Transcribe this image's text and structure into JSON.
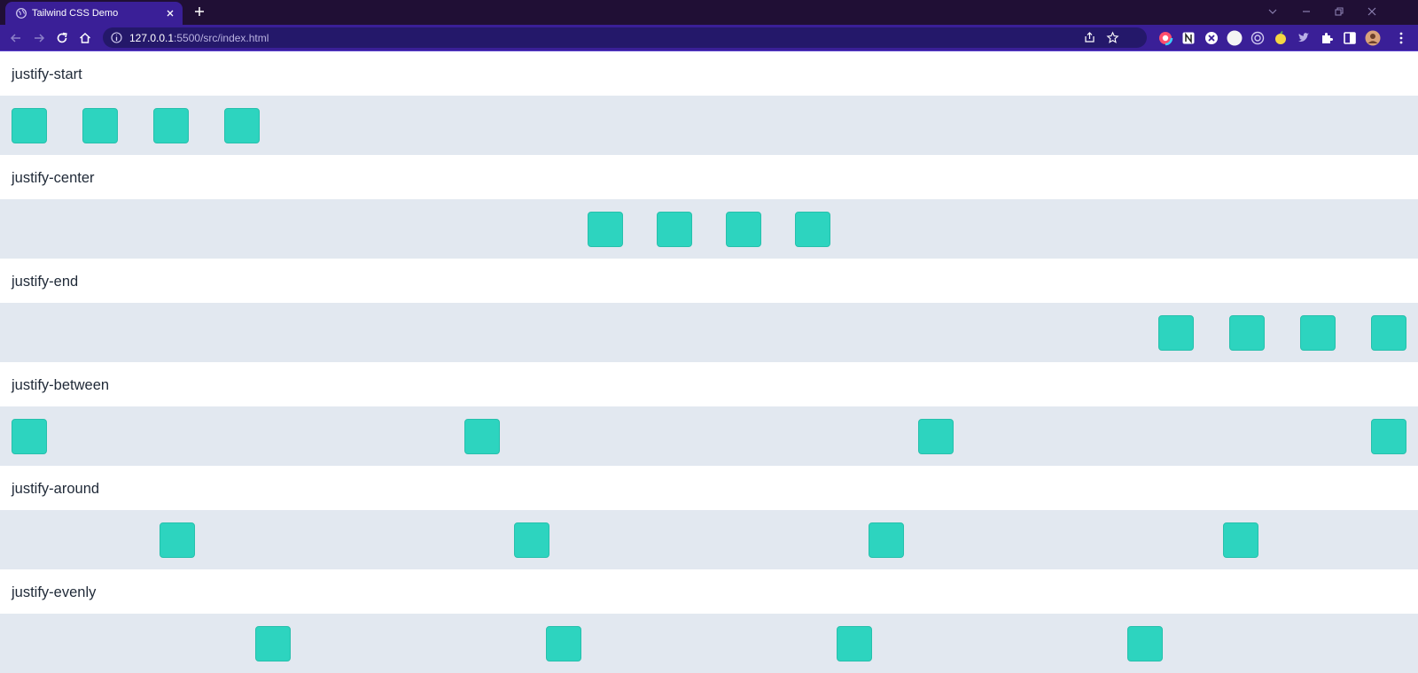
{
  "browser": {
    "tab_title": "Tailwind CSS Demo",
    "url_host": "127.0.0.1",
    "url_path": ":5500/src/index.html",
    "tab_color": "#3a1f97",
    "frame_color": "#200f35"
  },
  "sections": [
    {
      "label": "justify-start",
      "items": 4
    },
    {
      "label": "justify-center",
      "items": 4
    },
    {
      "label": "justify-end",
      "items": 4
    },
    {
      "label": "justify-between",
      "items": 4
    },
    {
      "label": "justify-around",
      "items": 4
    },
    {
      "label": "justify-evenly",
      "items": 4
    }
  ],
  "colors": {
    "box": "#2dd4bf",
    "row_background": "#e2e8f0",
    "label_text": "#1f2937"
  },
  "icons": [
    "globe-icon",
    "close-icon",
    "plus-icon",
    "back-arrow-icon",
    "forward-arrow-icon",
    "reload-icon",
    "home-icon",
    "info-icon",
    "share-icon",
    "star-icon",
    "extensions-puzzle-icon",
    "side-panel-icon",
    "profile-avatar",
    "menu-kebab-icon"
  ]
}
